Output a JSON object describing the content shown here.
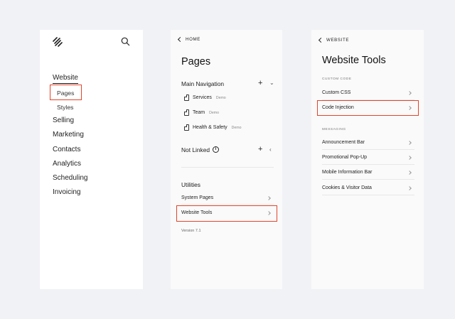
{
  "panel1": {
    "nav": [
      "Website",
      "Selling",
      "Marketing",
      "Contacts",
      "Analytics",
      "Scheduling",
      "Invoicing"
    ],
    "sub": [
      "Pages",
      "Styles"
    ]
  },
  "panel2": {
    "back": "HOME",
    "title": "Pages",
    "main_nav": "Main Navigation",
    "pages": [
      {
        "name": "Services",
        "tag": "Demo"
      },
      {
        "name": "Team",
        "tag": "Demo"
      },
      {
        "name": "Health & Safety",
        "tag": "Demo"
      }
    ],
    "not_linked": "Not Linked",
    "info_glyph": "i",
    "utilities": "Utilities",
    "system_pages": "System Pages",
    "website_tools": "Website Tools",
    "version": "Version 7.1"
  },
  "panel3": {
    "back": "WEBSITE",
    "title": "Website Tools",
    "custom_code_label": "CUSTOM CODE",
    "custom_code_items": [
      "Custom CSS",
      "Code Injection"
    ],
    "messaging_label": "MESSAGING",
    "messaging_items": [
      "Announcement Bar",
      "Promotional Pop-Up",
      "Mobile Information Bar",
      "Cookies & Visitor Data"
    ]
  },
  "colors": {
    "highlight": "#e0452b",
    "background": "#f1f2f5"
  },
  "icons": [
    "squarespace-logo-icon",
    "search-icon",
    "page-icon",
    "plus-icon",
    "chevron-down-icon",
    "chevron-left-icon",
    "chevron-right-icon",
    "info-icon",
    "back-chevron-icon"
  ]
}
